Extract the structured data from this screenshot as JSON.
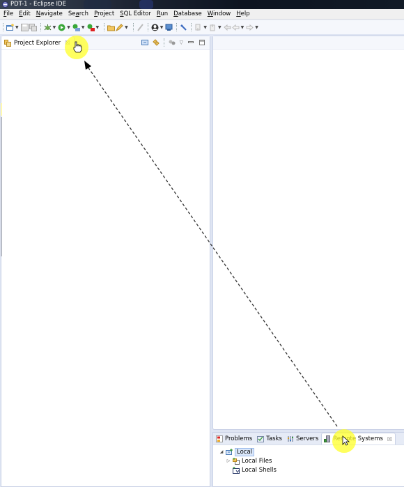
{
  "window": {
    "title": "PDT-1 - Eclipse IDE"
  },
  "menubar": {
    "items": [
      {
        "label": "File",
        "mnemonic": "F"
      },
      {
        "label": "Edit",
        "mnemonic": "E"
      },
      {
        "label": "Navigate",
        "mnemonic": "N"
      },
      {
        "label": "Search",
        "mnemonic": "a"
      },
      {
        "label": "Project",
        "mnemonic": "P"
      },
      {
        "label": "SQL Editor",
        "mnemonic": "S"
      },
      {
        "label": "Run",
        "mnemonic": "R"
      },
      {
        "label": "Database",
        "mnemonic": "D"
      },
      {
        "label": "Window",
        "mnemonic": "W"
      },
      {
        "label": "Help",
        "mnemonic": "H"
      }
    ]
  },
  "toolbar": {
    "buttons": [
      "new-icon",
      "save-icon",
      "save-all-icon",
      "debug-icon",
      "run-icon",
      "coverage-icon",
      "external-tools-icon",
      "open-type-icon",
      "search-tool-icon",
      "annotation-icon",
      "perspective-icon",
      "display-icon",
      "toggle-icon",
      "next-annotation-icon",
      "prev-annotation-icon",
      "last-edit-icon",
      "back-icon",
      "forward-icon"
    ]
  },
  "project_explorer": {
    "tab_label": "Project Explorer",
    "close_glyph": "☒",
    "actions": [
      "collapse-all-icon",
      "link-with-editor-icon",
      "focus-icon",
      "view-menu-icon",
      "minimize-icon",
      "maximize-icon"
    ]
  },
  "bottom_panel": {
    "tabs": [
      {
        "label": "Problems",
        "icon": "problems-icon",
        "active": false
      },
      {
        "label": "Tasks",
        "icon": "tasks-icon",
        "active": false
      },
      {
        "label": "Servers",
        "icon": "servers-icon",
        "active": false
      },
      {
        "label": "Remote Systems",
        "icon": "remote-systems-icon",
        "active": true
      }
    ],
    "close_glyph": "☒",
    "tree": [
      {
        "label": "Local",
        "expanded": true,
        "selected": true,
        "level": 0
      },
      {
        "label": "Local Files",
        "expanded": false,
        "selected": false,
        "level": 1
      },
      {
        "label": "Local Shells",
        "expanded": null,
        "selected": false,
        "level": 1
      }
    ]
  },
  "annotation": {
    "type": "drag-arrow",
    "from": "remote-systems-tab",
    "to": "project-explorer-tab-area",
    "highlight_color": "#ffff28"
  }
}
